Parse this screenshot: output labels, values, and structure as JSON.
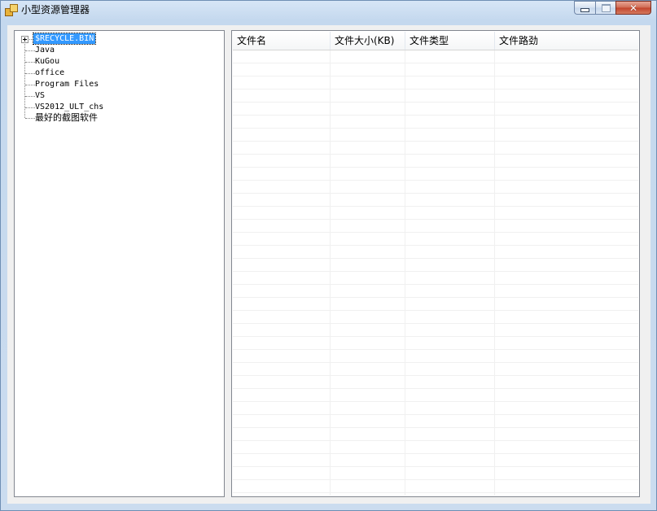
{
  "window": {
    "title": "小型资源管理器",
    "close_glyph": "✕"
  },
  "tree": {
    "items": [
      {
        "label": "$RECYCLE.BIN",
        "selected": true,
        "expandable": true
      },
      {
        "label": "Java"
      },
      {
        "label": "KuGou"
      },
      {
        "label": "office"
      },
      {
        "label": "Program Files"
      },
      {
        "label": "VS"
      },
      {
        "label": "VS2012_ULT_chs"
      },
      {
        "label": "最好的截图软件"
      }
    ]
  },
  "list": {
    "columns": [
      "文件名",
      "文件大小(KB)",
      "文件类型",
      "文件路劲"
    ]
  },
  "colors": {
    "selection": "#3399ff",
    "close_button": "#c2432b"
  }
}
